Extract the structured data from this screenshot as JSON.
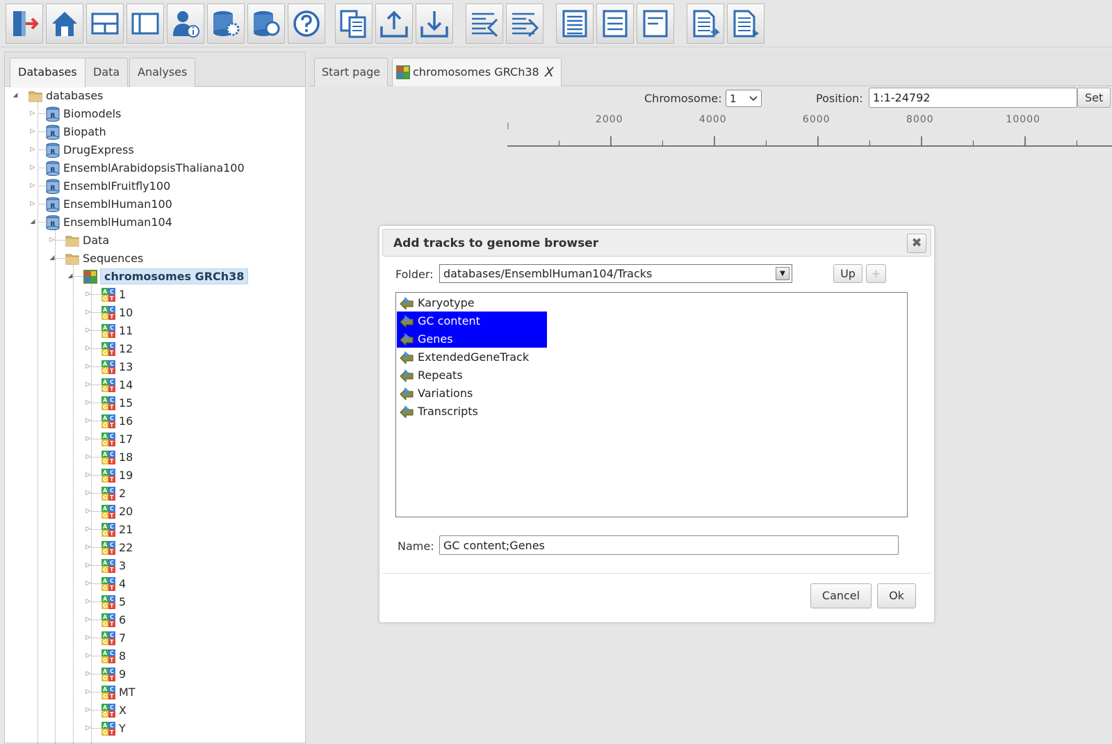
{
  "toolbar": {
    "buttons": [
      {
        "name": "exit-icon"
      },
      {
        "name": "home-icon"
      },
      {
        "name": "layout-horizontal-icon"
      },
      {
        "name": "layout-panel-icon"
      },
      {
        "name": "user-info-icon"
      },
      {
        "name": "database-settings-icon"
      },
      {
        "name": "database-search-icon"
      },
      {
        "name": "help-icon"
      },
      {
        "name": "copy-document-icon"
      },
      {
        "name": "upload-icon"
      },
      {
        "name": "download-icon"
      },
      {
        "name": "import-document-icon"
      },
      {
        "name": "export-document-icon"
      },
      {
        "name": "panel-list-icon"
      },
      {
        "name": "panel-list-small-icon"
      },
      {
        "name": "panel-list-single-icon"
      },
      {
        "name": "document-arrow-icon"
      },
      {
        "name": "document-arrow-right-icon"
      }
    ]
  },
  "left_panel": {
    "tabs": [
      {
        "label": "Databases",
        "active": true
      },
      {
        "label": "Data",
        "active": false
      },
      {
        "label": "Analyses",
        "active": false
      }
    ]
  },
  "tree": {
    "root": "databases",
    "databases": [
      "Biomodels",
      "Biopath",
      "DrugExpress",
      "EnsemblArabidopsisThaliana100",
      "EnsemblFruitfly100",
      "EnsemblHuman100",
      "EnsemblHuman104"
    ],
    "folders": [
      "Data",
      "Sequences"
    ],
    "selected": "chromosomes GRCh38",
    "chromosomes": [
      "1",
      "10",
      "11",
      "12",
      "13",
      "14",
      "15",
      "16",
      "17",
      "18",
      "19",
      "2",
      "20",
      "21",
      "22",
      "3",
      "4",
      "5",
      "6",
      "7",
      "8",
      "9",
      "MT",
      "X",
      "Y"
    ]
  },
  "doc_tabs": [
    {
      "label": "Start page",
      "active": false
    },
    {
      "label": "chromosomes GRCh38",
      "active": true,
      "close": "X"
    }
  ],
  "genome_browser": {
    "chromosome_label": "Chromosome:",
    "chromosome_value": "1",
    "position_label": "Position:",
    "position_value": "1:1-24792",
    "set_label": "Set",
    "ruler_ticks": [
      "2000",
      "4000",
      "6000",
      "8000",
      "10000"
    ]
  },
  "dialog": {
    "title": "Add tracks to genome browser",
    "close": "✖",
    "folder_label": "Folder:",
    "folder_value": "databases/EnsemblHuman104/Tracks",
    "up_label": "Up",
    "new_label": "+",
    "tracks": [
      {
        "label": "Karyotype",
        "selected": false
      },
      {
        "label": "GC content",
        "selected": true
      },
      {
        "label": "Genes",
        "selected": true
      },
      {
        "label": "ExtendedGeneTrack",
        "selected": false
      },
      {
        "label": "Repeats",
        "selected": false
      },
      {
        "label": "Variations",
        "selected": false
      },
      {
        "label": "Transcripts",
        "selected": false
      }
    ],
    "name_label": "Name:",
    "name_value": "GC content;Genes",
    "cancel_label": "Cancel",
    "ok_label": "Ok"
  },
  "colors": {
    "selection_blue": "#0000ff",
    "tree_selection": "#d4e6f4",
    "icon_blue": "#2f6db3"
  }
}
